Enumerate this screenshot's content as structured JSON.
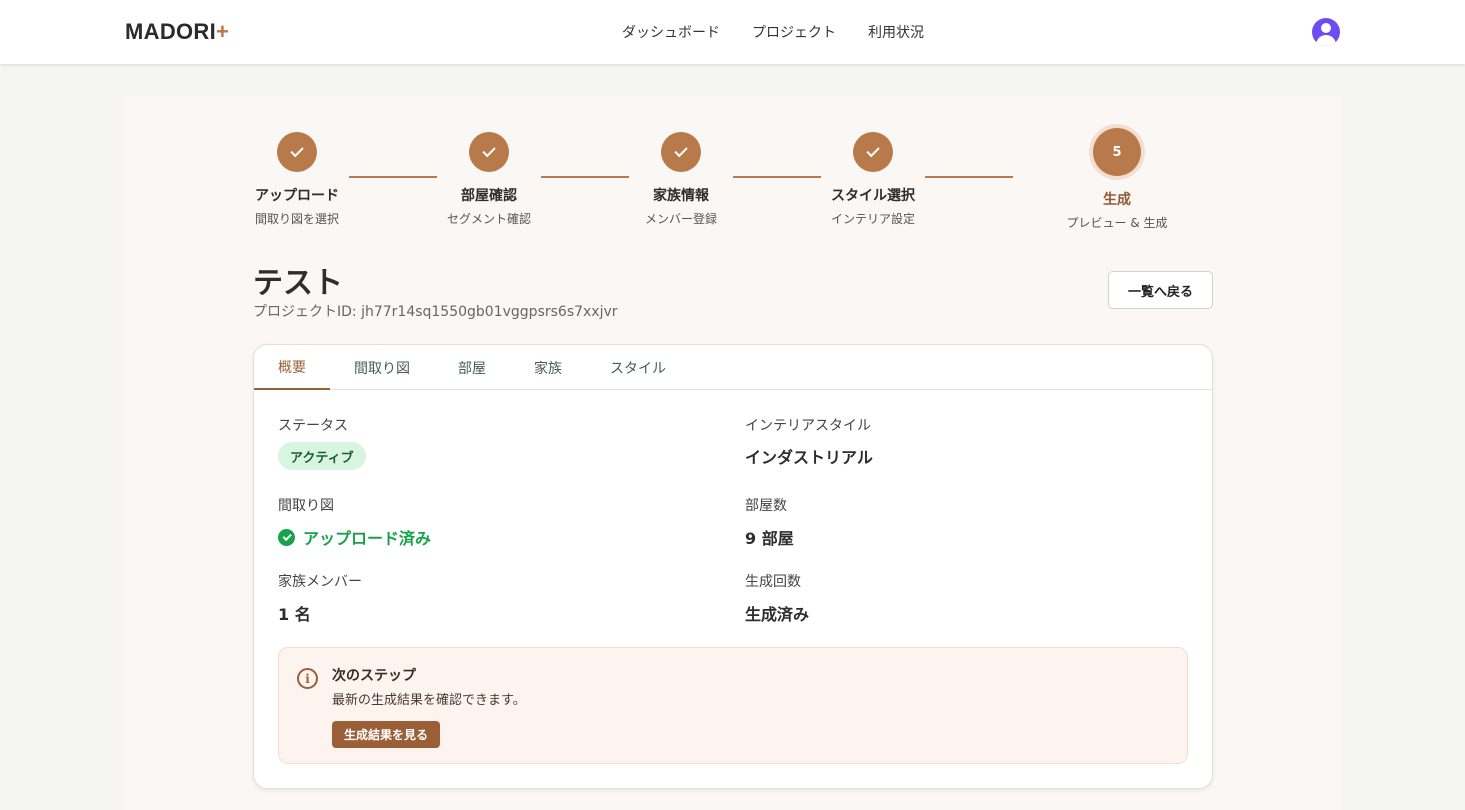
{
  "header": {
    "logo_text": "MADORI",
    "logo_plus": "+",
    "nav": [
      "ダッシュボード",
      "プロジェクト",
      "利用状況"
    ]
  },
  "stepper": {
    "steps": [
      {
        "label": "アップロード",
        "sub": "間取り図を選択",
        "state": "done"
      },
      {
        "label": "部屋確認",
        "sub": "セグメント確認",
        "state": "done"
      },
      {
        "label": "家族情報",
        "sub": "メンバー登録",
        "state": "done"
      },
      {
        "label": "スタイル選択",
        "sub": "インテリア設定",
        "state": "done"
      },
      {
        "label": "生成",
        "sub": "プレビュー & 生成",
        "state": "active",
        "number": "5"
      }
    ]
  },
  "project": {
    "title": "テスト",
    "id_text": "プロジェクトID: jh77r14sq1550gb01vggpsrs6s7xxjvr",
    "back_label": "一覧へ戻る"
  },
  "tabs": [
    "概要",
    "間取り図",
    "部屋",
    "家族",
    "スタイル"
  ],
  "active_tab": 0,
  "overview": {
    "status_label": "ステータス",
    "status_value": "アクティブ",
    "style_label": "インテリアスタイル",
    "style_value": "インダストリアル",
    "floorplan_label": "間取り図",
    "floorplan_value": "アップロード済み",
    "rooms_label": "部屋数",
    "rooms_value": "9 部屋",
    "family_label": "家族メンバー",
    "family_value": "1 名",
    "gen_label": "生成回数",
    "gen_value": "生成済み"
  },
  "next_step": {
    "title": "次のステップ",
    "desc": "最新の生成結果を確認できます。",
    "button": "生成結果を見る"
  },
  "colors": {
    "accent": "#b87a4b",
    "accent_dark": "#9a5f36",
    "success": "#16a34a",
    "avatar": "#6d4df2"
  }
}
